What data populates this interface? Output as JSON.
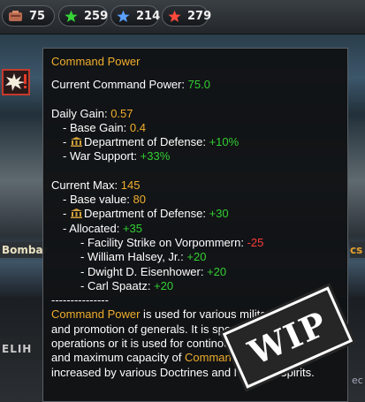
{
  "resources": [
    {
      "name": "command-power",
      "value": "75",
      "icon": "command-power-icon",
      "color": "#c77a5a"
    },
    {
      "name": "green-army-xp",
      "value": "259",
      "icon": "star-icon",
      "color": "#37d337"
    },
    {
      "name": "navy-xp",
      "value": "214",
      "icon": "star-icon",
      "color": "#5aa0ff"
    },
    {
      "name": "air-xp",
      "value": "279",
      "icon": "star-icon",
      "color": "#ff4a3c"
    }
  ],
  "background": {
    "left_banner": "Bombar",
    "right_banner": "cs",
    "left_strip_label": "ELIH",
    "right_side_text": "ec"
  },
  "tooltip": {
    "title": "Command Power",
    "current_label": "Current Command Power: ",
    "current_value": "75.0",
    "daily_gain_label": "Daily Gain: ",
    "daily_gain_value": "0.57",
    "base_gain_label": "- Base Gain: ",
    "base_gain_value": "0.4",
    "dod_gain_label": "Department of Defense: ",
    "dod_gain_value": "+10%",
    "war_support_label": "- War Support: ",
    "war_support_value": "+33%",
    "current_max_label": "Current Max: ",
    "current_max_value": "145",
    "base_value_label": "- Base value: ",
    "base_value_value": "80",
    "dod_max_label": "Department of Defense: ",
    "dod_max_value": "+30",
    "allocated_label": "- Allocated: ",
    "allocated_value": "+35",
    "allocations": [
      {
        "label": "- Facility Strike on Vorpommern: ",
        "value": "-25",
        "kind": "neg"
      },
      {
        "label": "- William Halsey, Jr.: ",
        "value": "+20",
        "kind": "pos"
      },
      {
        "label": "- Dwight D. Eisenhower: ",
        "value": "+20",
        "kind": "pos"
      },
      {
        "label": "- Carl Spaatz: ",
        "value": "+20",
        "kind": "pos"
      }
    ],
    "separator": "---------------",
    "desc_term1": "Command Power",
    "desc_part1": " is used for various military operations and promotion of generals. It is spent on one time operations or it is used for continous operations. Growth and maximum capacity of ",
    "desc_term2": "Command Power",
    "desc_part2": " can be increased by various Doctrines and National Spirits."
  },
  "stamp": {
    "text": "WIP"
  }
}
